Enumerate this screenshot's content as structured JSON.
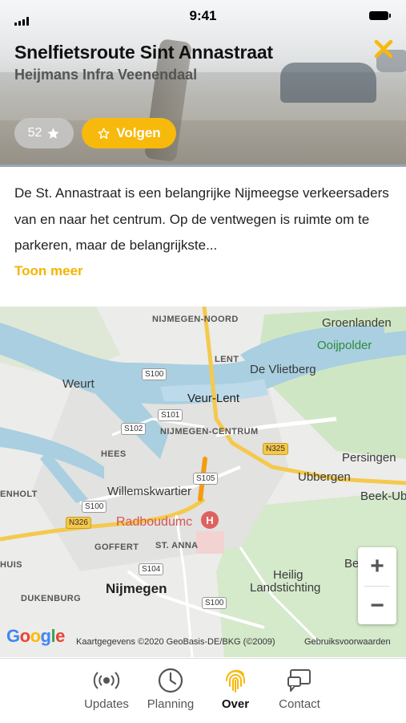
{
  "status_bar": {
    "time": "9:41"
  },
  "header": {
    "title": "Snelfietsroute Sint Annastraat",
    "subtitle": "Heijmans Infra Veenendaal",
    "rating_count": "52",
    "follow_label": "Volgen",
    "accent_color": "#f7b90b"
  },
  "description": {
    "text": "De St. Annastraat is een belangrijke Nijmeegse verkeersaders van en naar het centrum. Op de ventwegen is ruimte om te parkeren, maar de belangrijkste...",
    "more_label": "Toon meer"
  },
  "map": {
    "labels": {
      "nijmegen_noord": "NIJMEGEN-NOORD",
      "groenlanden": "Groenlanden",
      "ooijpolder": "Ooijpolder",
      "lent": "LENT",
      "de_vlietberg": "De Vlietberg",
      "weurt": "Weurt",
      "veur_lent": "Veur-Lent",
      "nijmegen_centrum": "NIJMEGEN-CENTRUM",
      "hees": "HEES",
      "persingen": "Persingen",
      "ubbergen": "Ubbergen",
      "beek_ubbergen": "Beek-Ub",
      "willemskwartier": "Willemskwartier",
      "denholt": "ENHOLT",
      "radboudumc": "Radboudumc",
      "goffert": "GOFFERT",
      "st_anna": "ST. ANNA",
      "huis": "HUIS",
      "heilig_landstichting_1": "Heilig",
      "heilig_landstichting_2": "Landstichting",
      "be": "Be",
      "dukenburg": "DUKENBURG",
      "nijmegen": "Nijmegen"
    },
    "shields": {
      "s100a": "S100",
      "s101": "S101",
      "s102": "S102",
      "s105": "S105",
      "s100b": "S100",
      "n326": "N326",
      "n325": "N325",
      "s104": "S104",
      "s100c": "S100"
    },
    "google_logo": "Google",
    "attribution": "Kaartgegevens ©2020 GeoBasis-DE/BKG (©2009)",
    "terms": "Gebruiksvoorwaarden",
    "zoom_in": "+",
    "zoom_out": "−"
  },
  "tabbar": {
    "tabs": [
      {
        "label": "Updates",
        "icon": "broadcast-icon"
      },
      {
        "label": "Planning",
        "icon": "clock-icon"
      },
      {
        "label": "Over",
        "icon": "fingerprint-icon",
        "active": true
      },
      {
        "label": "Contact",
        "icon": "chat-icon"
      }
    ]
  }
}
